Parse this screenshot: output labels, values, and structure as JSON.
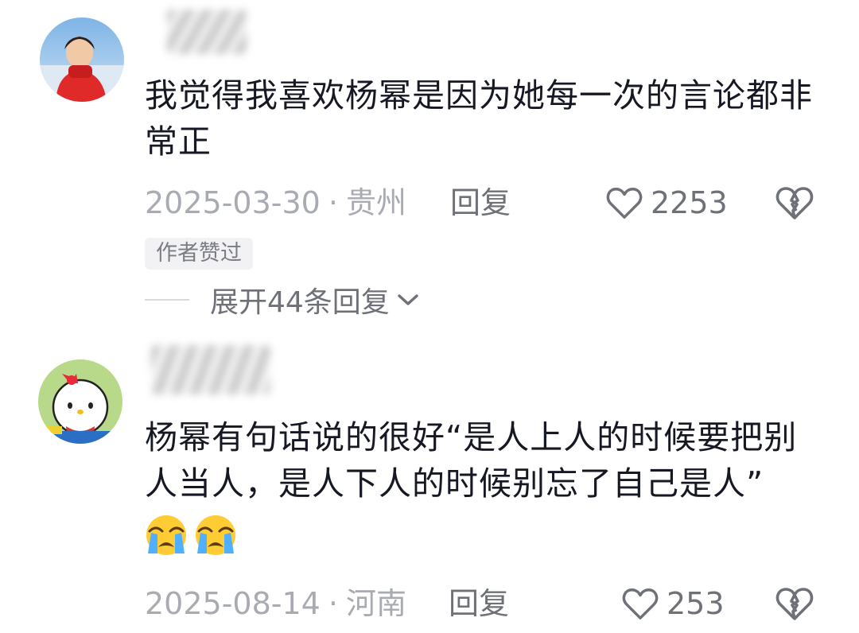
{
  "comments": [
    {
      "text": "我觉得我喜欢杨幂是因为她每一次的言论都非常正",
      "date": "2025-03-30",
      "location": "贵州",
      "reply_label": "回复",
      "likes": "2253",
      "author_badge": "作者赞过",
      "expand_label": "展开44条回复"
    },
    {
      "text": "杨幂有句话说的很好“是人上人的时候要把别人当人，是人下人的时候别忘了自己是人”",
      "emojis": [
        "crying-face",
        "crying-face"
      ],
      "date": "2025-08-14",
      "location": "河南",
      "reply_label": "回复",
      "likes": "253"
    }
  ],
  "meta_separator": "·",
  "colors": {
    "text": "#161823",
    "meta": "#a9abb2",
    "action": "#6f7178",
    "badge_bg": "#f2f2f4"
  }
}
